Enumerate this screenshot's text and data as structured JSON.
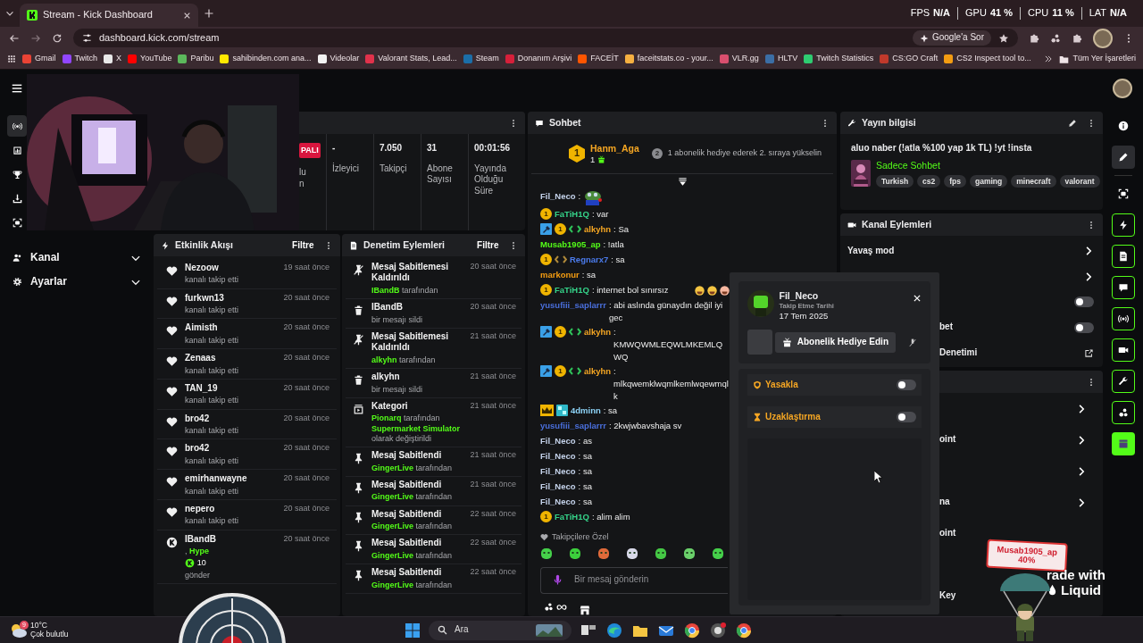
{
  "browser": {
    "tab_title": "Stream - Kick Dashboard",
    "address": "dashboard.kick.com/stream",
    "ask_button": "Google'a Sor",
    "all_bookmarks": "Tüm Yer İşaretleri",
    "bookmarks": [
      {
        "label": "Gmail",
        "color": "#ea4335"
      },
      {
        "label": "Twitch",
        "color": "#9146ff"
      },
      {
        "label": "X",
        "color": "#e8e8e8"
      },
      {
        "label": "YouTube",
        "color": "#ff0000"
      },
      {
        "label": "Paribu",
        "color": "#5cb85c"
      },
      {
        "label": "sahibinden.com ana...",
        "color": "#ffe800"
      },
      {
        "label": "Videolar",
        "color": "#f2f2f2"
      },
      {
        "label": "Valorant Stats, Lead...",
        "color": "#e0324b"
      },
      {
        "label": "Steam",
        "color": "#1b6ea8"
      },
      {
        "label": "Donanım Arşivi",
        "color": "#d6203a"
      },
      {
        "label": "FACEİT",
        "color": "#ff5500"
      },
      {
        "label": "faceitstats.co - your...",
        "color": "#f5b041"
      },
      {
        "label": "VLR.gg",
        "color": "#d94f6e"
      },
      {
        "label": "HLTV",
        "color": "#3b6ea5"
      },
      {
        "label": "Twitch Statistics",
        "color": "#2ecc71"
      },
      {
        "label": "CS:GO Craft",
        "color": "#c0392b"
      },
      {
        "label": "CS2 Inspect tool to...",
        "color": "#f39c12"
      }
    ]
  },
  "perf_overlay": [
    {
      "label": "FPS",
      "value": "N/A"
    },
    {
      "label": "GPU",
      "value": "41 %"
    },
    {
      "label": "CPU",
      "value": "11 %"
    },
    {
      "label": "LAT",
      "value": "N/A"
    }
  ],
  "left_rail": [
    {
      "kind": "broadcast",
      "selected": true
    },
    {
      "kind": "chart",
      "selected": false
    },
    {
      "kind": "trophy",
      "selected": false
    },
    {
      "kind": "upload",
      "selected": false
    },
    {
      "kind": "camera",
      "selected": false
    }
  ],
  "sidebar": {
    "items": [
      {
        "kind": "users",
        "label": "Kanal",
        "expanded": false
      },
      {
        "kind": "gear",
        "label": "Ayarlar",
        "expanded": false
      }
    ]
  },
  "stats_card": {
    "stats": [
      {
        "kind": "badge",
        "value": "PALI",
        "label": "lu\nn"
      },
      {
        "kind": "plain",
        "value": "-",
        "label": "İzleyici"
      },
      {
        "kind": "plain",
        "value": "7.050",
        "label": "Takipçi"
      },
      {
        "kind": "plain",
        "value": "31",
        "label": "Abone Sayısı"
      },
      {
        "kind": "plain",
        "value": "00:01:56",
        "label": "Yayında Olduğu Süre"
      }
    ]
  },
  "activity_feed": {
    "title": "Etkinlik Akışı",
    "filter": "Filtre",
    "items": [
      {
        "kind": "follow",
        "name": "Nezoow",
        "text": "kanalı takip etti",
        "time": "19 saat önce"
      },
      {
        "kind": "follow",
        "name": "furkwn13",
        "text": "kanalı takip etti",
        "time": "20 saat önce"
      },
      {
        "kind": "follow",
        "name": "Aimisth",
        "text": "kanalı takip etti",
        "time": "20 saat önce"
      },
      {
        "kind": "follow",
        "name": "Zenaas",
        "text": "kanalı takip etti",
        "time": "20 saat önce"
      },
      {
        "kind": "follow",
        "name": "TAN_19",
        "text": "kanalı takip etti",
        "time": "20 saat önce"
      },
      {
        "kind": "follow",
        "name": "bro42",
        "text": "kanalı takip etti",
        "time": "20 saat önce"
      },
      {
        "kind": "follow",
        "name": "bro42",
        "text": "kanalı takip etti",
        "time": "20 saat önce"
      },
      {
        "kind": "follow",
        "name": "emirhanwayne",
        "text": "kanalı takip etti",
        "time": "20 saat önce"
      },
      {
        "kind": "follow",
        "name": "nepero",
        "text": "kanalı takip etti",
        "time": "20 saat önce"
      },
      {
        "kind": "kick",
        "name": "IBandB",
        "prefix": ",",
        "highlight": "Hype",
        "amount": "10",
        "text": "gönder",
        "time": "20 saat önce"
      }
    ]
  },
  "moderation": {
    "title": "Denetim Eylemleri",
    "filter": "Filtre",
    "items": [
      {
        "kind": "unpin",
        "title": "Mesaj Sabitlemesi Kaldırıldı",
        "actor": "IBandB",
        "suffix": "tarafından",
        "time": "20 saat önce"
      },
      {
        "kind": "delete",
        "title": "IBandB",
        "detail": "bir mesajı sildi",
        "time": "20 saat önce"
      },
      {
        "kind": "unpin",
        "title": "Mesaj Sabitlemesi Kaldırıldı",
        "actor": "alkyhn",
        "suffix": "tarafından",
        "time": "21 saat önce"
      },
      {
        "kind": "delete",
        "title": "alkyhn",
        "detail": "bir mesajı sildi",
        "time": "21 saat önce"
      },
      {
        "kind": "category",
        "title": "Kategori",
        "actor": "Pionarq",
        "suffix": "tarafından",
        "target": "Supermarket Simulator",
        "detail": "olarak değiştirildi",
        "time": "21 saat önce"
      },
      {
        "kind": "pin",
        "title": "Mesaj Sabitlendi",
        "actor": "GingerLive",
        "suffix": "tarafından",
        "time": "21 saat önce"
      },
      {
        "kind": "pin",
        "title": "Mesaj Sabitlendi",
        "actor": "GingerLive",
        "suffix": "tarafından",
        "time": "21 saat önce"
      },
      {
        "kind": "pin",
        "title": "Mesaj Sabitlendi",
        "actor": "GingerLive",
        "suffix": "tarafından",
        "time": "22 saat önce"
      },
      {
        "kind": "pin",
        "title": "Mesaj Sabitlendi",
        "actor": "GingerLive",
        "suffix": "tarafından",
        "time": "22 saat önce"
      },
      {
        "kind": "pin",
        "title": "Mesaj Sabitlendi",
        "actor": "GingerLive",
        "suffix": "tarafından",
        "time": "22 saat önce"
      }
    ]
  },
  "chat": {
    "title": "Sohbet",
    "leader": {
      "rank": "1",
      "name": "Hanm_Aga",
      "count": "1",
      "prompt_rank": "2",
      "prompt": "1 abonelik hediye ederek 2. sıraya yükselin"
    },
    "messages": [
      {
        "kind": "emote",
        "user": "Fil_Neco",
        "color": "#c4d2ea",
        "text": ":"
      },
      {
        "kind": "text",
        "user": "FaTiH1Q",
        "color": "#35d389",
        "badges": [
          {
            "kind": "tier",
            "label": "1"
          }
        ],
        "text": ": var"
      },
      {
        "kind": "text",
        "user": "alkyhn",
        "color": "#f5a623",
        "badges": [
          {
            "kind": "moderator"
          },
          {
            "kind": "tier",
            "label": "1"
          },
          {
            "kind": "sub"
          }
        ],
        "text": ": Sa"
      },
      {
        "kind": "text",
        "user": "Musab1905_ap",
        "color": "#53fc18",
        "text": ": !atla"
      },
      {
        "kind": "text",
        "user": "Regnarx7",
        "color": "#4b7bec",
        "badges": [
          {
            "kind": "tier",
            "label": "1"
          },
          {
            "kind": "former-sub"
          }
        ],
        "text": ": sa"
      },
      {
        "kind": "text",
        "user": "markonur",
        "color": "#f39c12",
        "text": ": sa"
      },
      {
        "kind": "text",
        "user": "FaTiH1Q",
        "color": "#35d389",
        "badges": [
          {
            "kind": "tier",
            "label": "1"
          }
        ],
        "text": ": internet bol sınırsız",
        "emotes": [
          {
            "kind": "laugh"
          },
          {
            "kind": "laugh"
          },
          {
            "kind": "grin"
          }
        ]
      },
      {
        "kind": "text",
        "user": "yusufiii_saplarrr",
        "color": "#4a6fdc",
        "text": ": abi aslında günaydın değil iyi gec"
      },
      {
        "kind": "text",
        "user": "alkyhn",
        "color": "#f5a623",
        "badges": [
          {
            "kind": "moderator"
          },
          {
            "kind": "tier",
            "label": "1"
          },
          {
            "kind": "sub"
          }
        ],
        "text": ": KMWQWMLEQWLMKEMLQWQ"
      },
      {
        "kind": "text",
        "user": "alkyhn",
        "color": "#f5a623",
        "badges": [
          {
            "kind": "moderator"
          },
          {
            "kind": "tier",
            "label": "1"
          },
          {
            "kind": "sub"
          }
        ],
        "text": ": mlkqwemklwqmlkemlwqewmqlk"
      },
      {
        "kind": "text",
        "user": "4dminn",
        "color": "#8ed4f8",
        "badges": [
          {
            "kind": "crown"
          },
          {
            "kind": "staff"
          }
        ],
        "text": ": sa"
      },
      {
        "kind": "text",
        "user": "yusufiii_saplarrr",
        "color": "#4a6fdc",
        "text": ": 2kwjwbavshaja sv"
      },
      {
        "kind": "text",
        "user": "Fil_Neco",
        "color": "#c4d2ea",
        "text": ": as"
      },
      {
        "kind": "text",
        "user": "Fil_Neco",
        "color": "#c4d2ea",
        "text": ": sa"
      },
      {
        "kind": "text",
        "user": "Fil_Neco",
        "color": "#c4d2ea",
        "text": ": sa"
      },
      {
        "kind": "text",
        "user": "Fil_Neco",
        "color": "#c4d2ea",
        "text": ": sa"
      },
      {
        "kind": "text",
        "user": "Fil_Neco",
        "color": "#c4d2ea",
        "text": ": sa"
      },
      {
        "kind": "text",
        "user": "FaTiH1Q",
        "color": "#35d389",
        "badges": [
          {
            "kind": "tier",
            "label": "1"
          }
        ],
        "text": ": alim alim"
      }
    ],
    "followers_only": "Takipçilere Özel",
    "input": {
      "placeholder": "Bir mesaj gönderin"
    }
  },
  "stream_info": {
    "title": "Yayın bilgisi",
    "stream_title": "aluo naber (!atla %100 yap 1k TL) !yt !insta",
    "category": "Sadece Sohbet",
    "tags": [
      "Turkish",
      "cs2",
      "fps",
      "gaming",
      "minecraft",
      "valorant"
    ]
  },
  "channel_actions": {
    "title": "Kanal Eylemleri",
    "rows": [
      {
        "kind": "link",
        "label": "Yavaş mod"
      },
      {
        "kind": "link"
      },
      {
        "kind": "toggle",
        "on": false
      },
      {
        "kind": "toggle",
        "label": "bet",
        "on": false
      },
      {
        "kind": "external",
        "label": "Denetimi"
      }
    ]
  },
  "tools_panel": {
    "rows": [
      {
        "kind": "link"
      },
      {
        "kind": "link",
        "label": "oint"
      },
      {
        "kind": "link"
      },
      {
        "kind": "link",
        "label": "na"
      },
      {
        "kind": "plain",
        "label": "oint"
      },
      {
        "kind": "plain"
      },
      {
        "kind": "plain",
        "label": "Key"
      }
    ]
  },
  "right_rail": [
    {
      "kind": "info",
      "selected": false
    },
    {
      "kind": "pencil",
      "selected": true
    },
    {
      "kind": "camera",
      "selected": false
    },
    {
      "kind": "bolt",
      "selected": false
    },
    {
      "kind": "doc",
      "selected": false
    },
    {
      "kind": "chat",
      "selected": false
    },
    {
      "kind": "broadcast",
      "selected": false
    },
    {
      "kind": "videocam",
      "selected": false
    },
    {
      "kind": "wrench",
      "selected": false
    },
    {
      "kind": "bubbles",
      "selected": false
    },
    {
      "kind": "clapper",
      "selected": false
    }
  ],
  "user_card": {
    "name": "Fil_Neco",
    "follow_label": "Takip Etme Tarihi",
    "follow_date": "17 Tem 2025",
    "gift_button": "Abonelik Hediye Edin",
    "actions": [
      {
        "kind": "ban",
        "label": "Yasakla",
        "on": false
      },
      {
        "kind": "timeout",
        "label": "Uzaklaştırma",
        "on": false
      }
    ]
  },
  "overlays": {
    "sticker": {
      "name": "Musab1905_ap",
      "percent": "40%"
    },
    "ad": {
      "line1": "rade with",
      "line2": "Liquid"
    }
  },
  "taskbar": {
    "weather": {
      "badge": "9",
      "temp": "10°C",
      "desc": "Çok bulutlu"
    },
    "search": "Ara"
  }
}
